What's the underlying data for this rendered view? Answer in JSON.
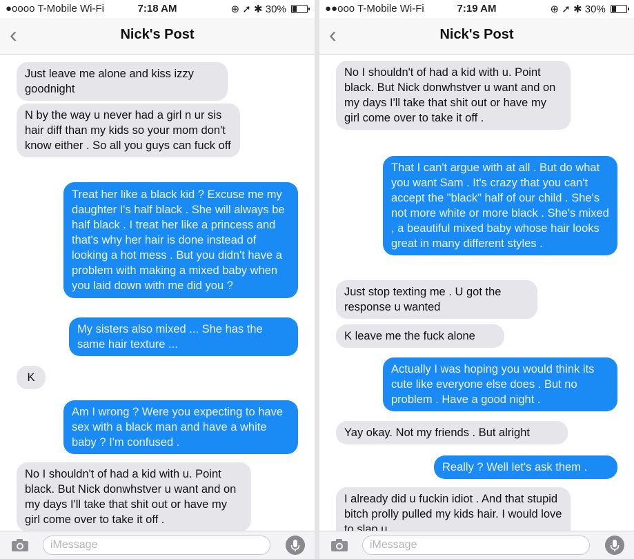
{
  "status_left": {
    "carrier": "●oooo T-Mobile Wi-Fi",
    "time": "7:18 AM",
    "battery": "30%"
  },
  "status_right": {
    "carrier": "●●ooo T-Mobile Wi-Fi",
    "time": "7:19 AM",
    "battery": "30%"
  },
  "nav": {
    "back_icon": "chevron-left",
    "title": "Nick's Post"
  },
  "input": {
    "placeholder": "iMessage"
  },
  "left_messages": [
    {
      "side": "received",
      "text": "Just leave me alone and kiss izzy goodnight"
    },
    {
      "side": "received",
      "text": "N by the way u never had a girl n ur sis hair diff than my kids so your mom don't know either . So all you guys can fuck off"
    },
    {
      "side": "sent",
      "text": "Treat her like a black kid ? Excuse me my daughter I's half black . She will always be half black . I treat her like a princess and that's why her hair is done instead of looking a hot mess . But you didn't have a problem with making a mixed baby when you laid down with me did you ?"
    },
    {
      "side": "sent",
      "text": "My sisters also mixed ... She has the same hair texture ..."
    },
    {
      "side": "received",
      "text": "K"
    },
    {
      "side": "sent",
      "text": "Am I wrong ? Were you expecting to have sex with a black man and have a white baby ? I'm confused ."
    },
    {
      "side": "received",
      "text": "No I shouldn't of had a kid with u. Point black. But Nick donwhstver u want and on my days I'll take that shit out or have my girl come over to take it off ."
    }
  ],
  "right_messages": [
    {
      "side": "received",
      "text": "No I shouldn't of had a kid with u. Point black. But Nick donwhstver u want and on my days I'll take that shit out or have my girl come over to take it off ."
    },
    {
      "side": "sent",
      "text": "That I can't argue with at all . But do what you want Sam . It's crazy that you can't accept the \"black\" half of our child . She's not more white or more black . She's mixed , a beautiful mixed baby whose hair looks great in many different styles ."
    },
    {
      "side": "received",
      "text": "Just stop texting me . U got the response u wanted"
    },
    {
      "side": "received",
      "text": "K leave me the fuck alone"
    },
    {
      "side": "sent",
      "text": "Actually I was hoping you would think its cute like everyone else does . But no problem . Have a good night ."
    },
    {
      "side": "received",
      "text": "Yay okay. Not my friends . But alright"
    },
    {
      "side": "sent",
      "text": "Really ? Well let's ask them ."
    },
    {
      "side": "received",
      "text": "I already did u fuckin idiot . And that stupid bitch prolly pulled my kids hair. I would love to slap u."
    }
  ]
}
